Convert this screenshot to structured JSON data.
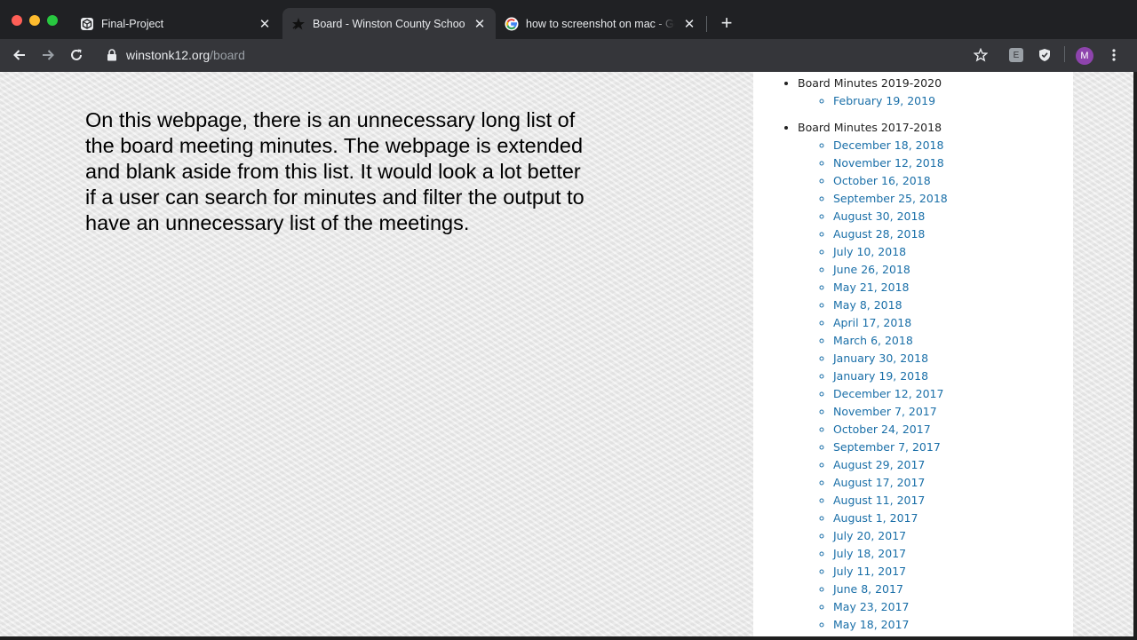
{
  "tabs": [
    {
      "title": "Final-Project",
      "icon": "codesandbox-icon",
      "active": false
    },
    {
      "title": "Board - Winston County Schools",
      "icon": "star-logo-icon",
      "active": true
    },
    {
      "title": "how to screenshot on mac - Goo",
      "icon": "google-g-icon",
      "active": false
    }
  ],
  "omnibox": {
    "host": "winstonk12.org",
    "path": "/board"
  },
  "profile": {
    "initial": "M"
  },
  "note": {
    "text": "On this webpage, there is an unnecessary long list of the board meeting minutes. The webpage is extended and blank aside from this list. It would look a lot better if a user can search for minutes and filter the output to have an unnecessary list of the meetings."
  },
  "minutes": [
    {
      "heading": "Board Minutes 2019-2020",
      "dates": [
        "February 19, 2019"
      ]
    },
    {
      "heading": "Board Minutes 2017-2018",
      "dates": [
        "December 18, 2018",
        "November 12, 2018",
        "October 16, 2018",
        "September 25, 2018",
        "August 30, 2018",
        "August 28, 2018",
        "July 10, 2018",
        "June 26, 2018",
        "May 21, 2018",
        "May 8, 2018",
        "April 17, 2018",
        "March 6, 2018",
        "January 30, 2018",
        "January 19, 2018",
        "December 12, 2017",
        "November 7, 2017",
        "October 24, 2017",
        "September 7, 2017",
        "August 29, 2017",
        "August 17, 2017",
        "August 11, 2017",
        "August 1, 2017",
        "July 20, 2017",
        "July 18, 2017",
        "July 11, 2017",
        "June 8, 2017",
        "May 23, 2017",
        "May 18, 2017"
      ]
    }
  ],
  "colors": {
    "link": "#1a6fa8",
    "tabbar": "#202124",
    "toolbar": "#35363a"
  }
}
